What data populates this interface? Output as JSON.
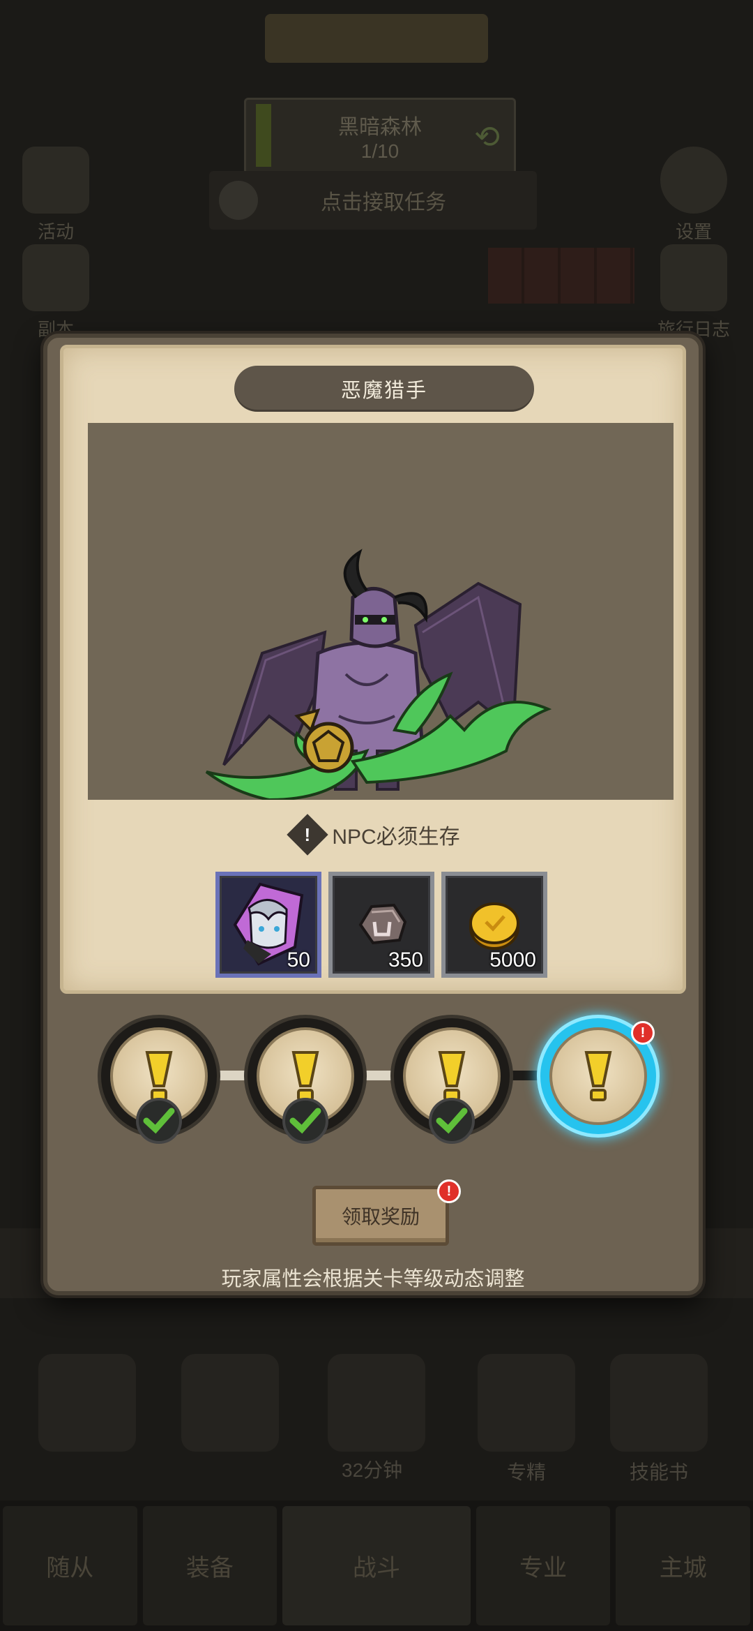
{
  "background": {
    "stage_name": "黑暗森林",
    "stage_progress": "1/10",
    "quest_prompt": "点击接取任务",
    "left_top_label": "活动",
    "right_top_label": "设置",
    "left_mid_label": "副本",
    "right_mid_label": "旅行日志",
    "skill_labels": [
      "专精",
      "技能书"
    ],
    "timer": "32分钟",
    "nav_tabs": [
      "随从",
      "装备",
      "战斗",
      "专业",
      "主城"
    ]
  },
  "dialog": {
    "title": "恶魔猎手",
    "notice": "NPC必须生存",
    "notice_icon": "exclamation",
    "rewards": [
      {
        "icon": "hero-portrait-icon",
        "qty": "50"
      },
      {
        "icon": "stone-icon",
        "qty": "350"
      },
      {
        "icon": "gold-coin-icon",
        "qty": "5000"
      }
    ],
    "stages": [
      {
        "icon": "exclamation-icon",
        "completed": true
      },
      {
        "icon": "exclamation-icon",
        "completed": true
      },
      {
        "icon": "exclamation-icon",
        "completed": true
      },
      {
        "icon": "exclamation-icon",
        "completed": false,
        "active": true
      }
    ],
    "claim_label": "领取奖励",
    "footnote": "玩家属性会根据关卡等级动态调整"
  },
  "colors": {
    "accent_active": "#26c3ee",
    "badge_red": "#e0302a",
    "check_green": "#5fbf3a",
    "gold": "#e8b923"
  }
}
